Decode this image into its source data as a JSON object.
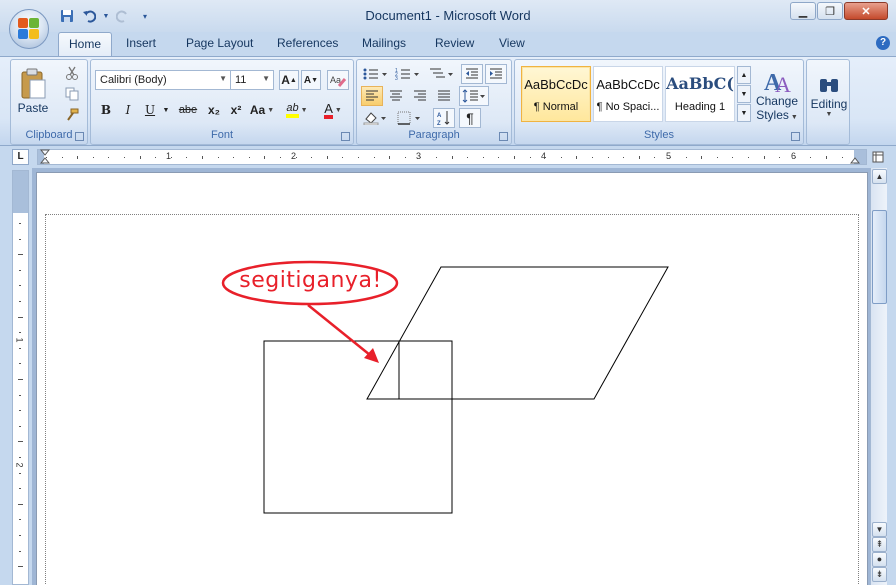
{
  "window": {
    "title": "Document1 - Microsoft Word",
    "controls": [
      "minimize",
      "maximize",
      "close"
    ]
  },
  "quick_access": [
    "save-icon",
    "undo-icon",
    "redo-icon",
    "customize-icon"
  ],
  "tabs": [
    {
      "label": "Home",
      "active": true
    },
    {
      "label": "Insert"
    },
    {
      "label": "Page Layout"
    },
    {
      "label": "References"
    },
    {
      "label": "Mailings"
    },
    {
      "label": "Review"
    },
    {
      "label": "View"
    }
  ],
  "clipboard": {
    "group_label": "Clipboard",
    "paste_label": "Paste"
  },
  "font": {
    "group_label": "Font",
    "font_name": "Calibri (Body)",
    "font_size": "11",
    "grow": "A",
    "shrink": "A",
    "bold": "B",
    "italic": "I",
    "underline": "U",
    "strike": "abe",
    "subscript": "x₂",
    "superscript": "x²",
    "change_case": "Aa",
    "highlight": "ab",
    "font_color": "A"
  },
  "paragraph": {
    "group_label": "Paragraph",
    "show_marks": "¶"
  },
  "styles": {
    "group_label": "Styles",
    "items": [
      {
        "sample": "AaBbCcDc",
        "name": "¶ Normal",
        "selected": true
      },
      {
        "sample": "AaBbCcDc",
        "name": "¶ No Spaci..."
      },
      {
        "sample": "AaBbC(",
        "name": "Heading 1"
      }
    ],
    "change_styles_line1": "Change",
    "change_styles_line2": "Styles"
  },
  "editing": {
    "label": "Editing"
  },
  "ruler": {
    "corner": "L",
    "numbers": [
      "1",
      "2",
      "3",
      "4",
      "5",
      "6"
    ],
    "vertical_numbers": [
      "1",
      "2"
    ]
  },
  "document": {
    "callout_text": "segitiganya!"
  },
  "colors": {
    "accent": "#e8202a",
    "ribbon": "#dbe7f6",
    "frame": "#c5d8ee"
  }
}
